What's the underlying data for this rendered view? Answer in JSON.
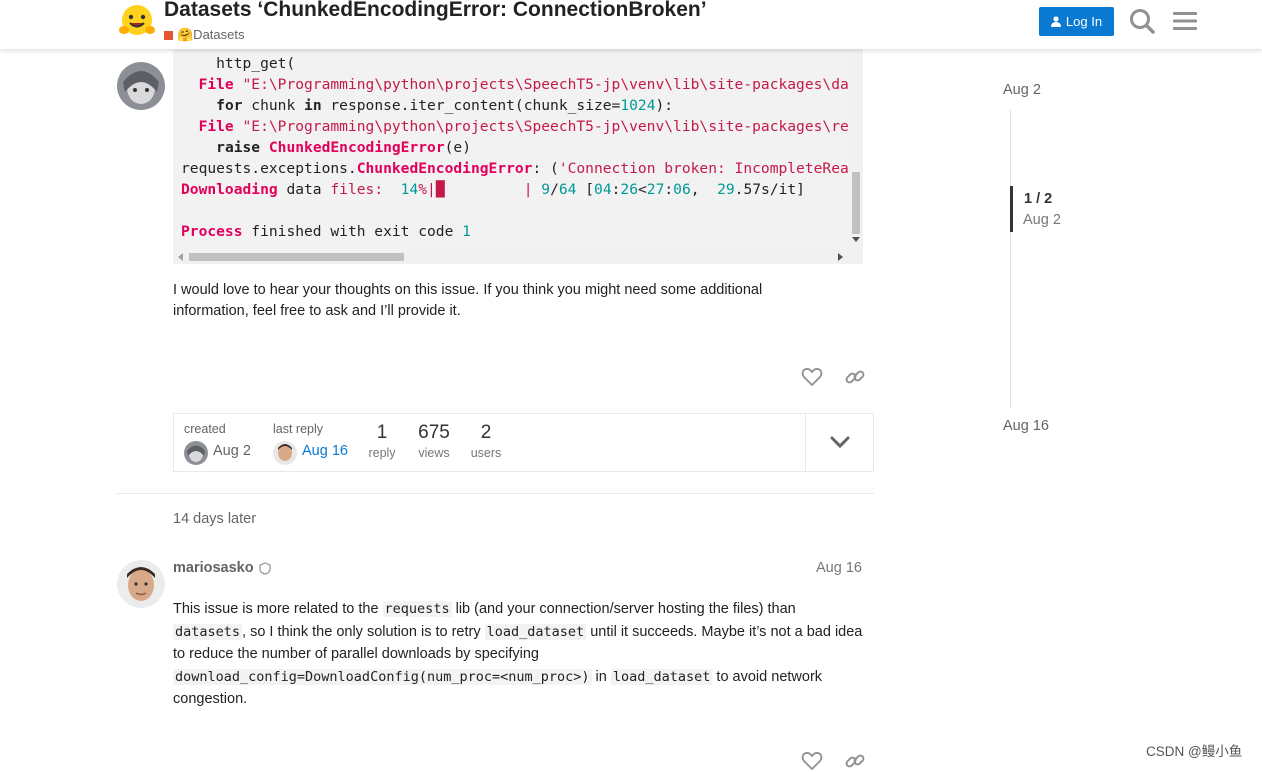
{
  "header": {
    "title": "Datasets ‘ChunkedEncodingError: ConnectionBroken’",
    "category": "🤗Datasets",
    "login_label": "Log In",
    "icons": [
      "hugging-face-logo",
      "search-icon",
      "hamburger-menu-icon"
    ]
  },
  "post1": {
    "code_lines": [
      {
        "parts": [
          {
            "t": "    http_get(",
            "c": "fn"
          }
        ]
      },
      {
        "parts": [
          {
            "t": "  ",
            "c": "fn"
          },
          {
            "t": "File",
            "c": "red"
          },
          {
            "t": " \"E:\\Programming\\python\\projects\\SpeechT5-jp\\venv\\lib\\site-packages\\datasets\\utils\\file_utils.py\"",
            "c": "str"
          }
        ]
      },
      {
        "parts": [
          {
            "t": "    ",
            "c": "fn"
          },
          {
            "t": "for",
            "c": "kw"
          },
          {
            "t": " chunk ",
            "c": "fn"
          },
          {
            "t": "in",
            "c": "kw"
          },
          {
            "t": " response.iter_content(chunk_size=",
            "c": "fn"
          },
          {
            "t": "1024",
            "c": "num"
          },
          {
            "t": "):",
            "c": "fn"
          }
        ]
      },
      {
        "parts": [
          {
            "t": "  ",
            "c": "fn"
          },
          {
            "t": "File",
            "c": "red"
          },
          {
            "t": " \"E:\\Programming\\python\\projects\\SpeechT5-jp\\venv\\lib\\site-packages\\requests\\models.py\"",
            "c": "str"
          }
        ]
      },
      {
        "parts": [
          {
            "t": "    ",
            "c": "fn"
          },
          {
            "t": "raise",
            "c": "kw"
          },
          {
            "t": " ",
            "c": "fn"
          },
          {
            "t": "ChunkedEncodingError",
            "c": "red"
          },
          {
            "t": "(e)",
            "c": "fn"
          }
        ]
      },
      {
        "parts": [
          {
            "t": "requests.exceptions.",
            "c": "fn"
          },
          {
            "t": "ChunkedEncodingError",
            "c": "red"
          },
          {
            "t": ": (",
            "c": "fn"
          },
          {
            "t": "'Connection broken: IncompleteRead(...)'",
            "c": "str"
          }
        ]
      },
      {
        "parts": [
          {
            "t": "Downloading",
            "c": "red"
          },
          {
            "t": " data ",
            "c": "fn"
          },
          {
            "t": "files",
            "c": "str"
          },
          {
            "t": ":  ",
            "c": "str"
          },
          {
            "t": "14",
            "c": "num"
          },
          {
            "t": "%|",
            "c": "str"
          },
          {
            "t": "█",
            "c": "str"
          },
          {
            "t": "         | ",
            "c": "str"
          },
          {
            "t": "9",
            "c": "num"
          },
          {
            "t": "/",
            "c": "fn"
          },
          {
            "t": "64",
            "c": "num"
          },
          {
            "t": " [",
            "c": "fn"
          },
          {
            "t": "04",
            "c": "num"
          },
          {
            "t": ":",
            "c": "fn"
          },
          {
            "t": "26",
            "c": "num"
          },
          {
            "t": "<",
            "c": "fn"
          },
          {
            "t": "27",
            "c": "num"
          },
          {
            "t": ":",
            "c": "fn"
          },
          {
            "t": "06",
            "c": "num"
          },
          {
            "t": ",  ",
            "c": "fn"
          },
          {
            "t": "29",
            "c": "num"
          },
          {
            "t": ".57s/it]",
            "c": "fn"
          }
        ]
      },
      {
        "parts": [
          {
            "t": "",
            "c": "fn"
          }
        ]
      },
      {
        "parts": [
          {
            "t": "Process",
            "c": "red"
          },
          {
            "t": " finished with exit code ",
            "c": "fn"
          },
          {
            "t": "1",
            "c": "num"
          }
        ]
      }
    ],
    "closing_text": "I would love to hear your thoughts on this issue. If you think you might need some additional information, feel free to ask and I’ll provide it."
  },
  "topic_map": {
    "created_label": "created",
    "created_date": "Aug 2",
    "last_reply_label": "last reply",
    "last_reply_date": "Aug 16",
    "reply_count": "1",
    "reply_label": "reply",
    "views_count": "675",
    "views_label": "views",
    "users_count": "2",
    "users_label": "users"
  },
  "gap_text": "14 days later",
  "post2": {
    "username": "mariosasko",
    "date": "Aug 16",
    "t1": "This issue is more related to the ",
    "c1": "requests",
    "t2": " lib (and your connection/server hosting the files) than ",
    "c2": "datasets",
    "t3": ", so I think the only solution is to retry ",
    "c3": "load_dataset",
    "t4": " until it succeeds. Maybe it’s not a bad idea to reduce the number of parallel downloads by specifying ",
    "c4": "download_config=DownloadConfig(num_proc=<num_proc>)",
    "t5": " in ",
    "c5": "load_dataset",
    "t6": " to avoid network congestion."
  },
  "timeline": {
    "top_date": "Aug 2",
    "position": "1 / 2",
    "position_date": "Aug 2",
    "bottom_date": "Aug 16"
  },
  "watermark": "CSDN @鳗小鱼",
  "colors": {
    "accent": "#0a79d1",
    "category": "#e45735"
  }
}
